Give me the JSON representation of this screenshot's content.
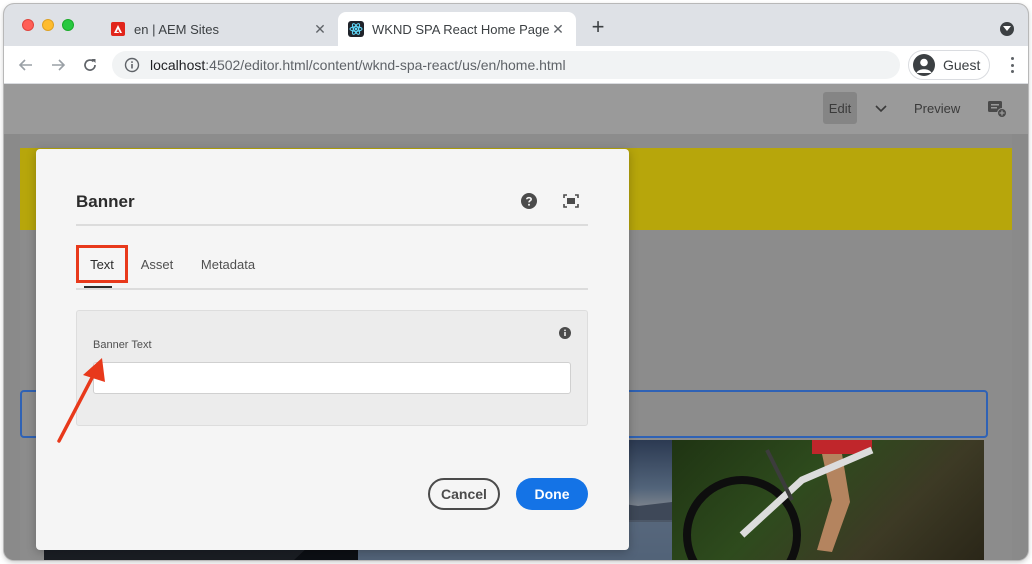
{
  "browser": {
    "tabs": [
      {
        "title": "en | AEM Sites",
        "icon": "adobe-icon",
        "active": false
      },
      {
        "title": "WKND SPA React Home Page",
        "icon": "react-icon",
        "active": true
      }
    ],
    "url_host": "localhost",
    "url_rest": ":4502/editor.html/content/wknd-spa-react/us/en/home.html",
    "profile_name": "Guest"
  },
  "editor": {
    "edit_label": "Edit",
    "preview_label": "Preview"
  },
  "dialog": {
    "title": "Banner",
    "tabs": [
      {
        "label": "Text",
        "selected": true
      },
      {
        "label": "Asset",
        "selected": false
      },
      {
        "label": "Metadata",
        "selected": false
      }
    ],
    "field_label": "Banner Text",
    "field_value": "",
    "cancel_label": "Cancel",
    "done_label": "Done"
  },
  "colors": {
    "accent": "#1473e6",
    "highlight": "#e8391b",
    "banner": "#b7a60b"
  }
}
